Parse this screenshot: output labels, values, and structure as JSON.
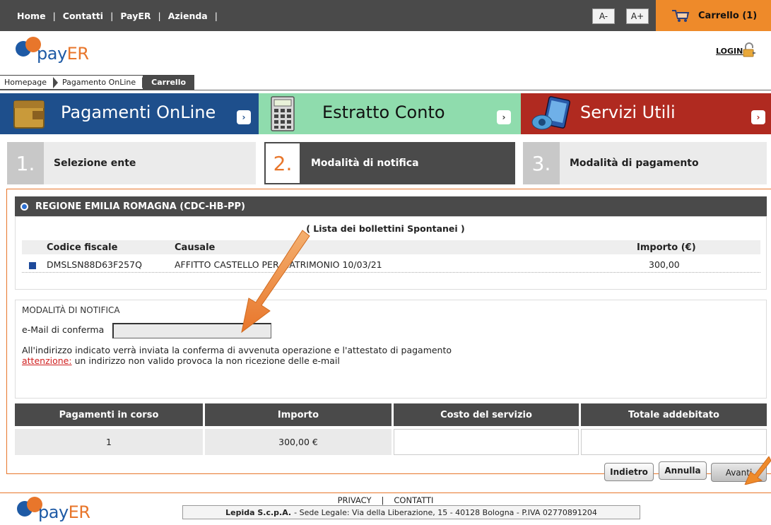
{
  "topnav": {
    "links": [
      "Home",
      "Contatti",
      "PayER",
      "Azienda"
    ],
    "font_decrease": "A-",
    "font_increase": "A+",
    "cart_label": "Carrello (1)"
  },
  "header": {
    "logo_text_a": "pay",
    "logo_text_b": "ER",
    "login": "LOGIN"
  },
  "breadcrumb": [
    "Homepage",
    "Pagamento OnLine",
    "Carrello"
  ],
  "tiles": [
    {
      "label": "Pagamenti OnLine",
      "color": "#1e4f8c",
      "text_color": "#ffffff"
    },
    {
      "label": "Estratto Conto",
      "color": "#8fdcad",
      "text_color": "#111111"
    },
    {
      "label": "Servizi Utili",
      "color": "#b02a20",
      "text_color": "#ffffff"
    }
  ],
  "steps": [
    {
      "num": "1.",
      "label": "Selezione ente"
    },
    {
      "num": "2.",
      "label": "Modalità di notifica"
    },
    {
      "num": "3.",
      "label": "Modalità di pagamento"
    }
  ],
  "ente": {
    "name": "REGIONE EMILIA ROMAGNA (CDC-HB-PP)",
    "list_title": "( Lista dei bollettini Spontanei )",
    "columns": [
      "Codice fiscale",
      "Causale",
      "Importo (€)"
    ],
    "rows": [
      {
        "codice": "DMSLSN88D63F257Q",
        "causale": "AFFITTO CASTELLO PER MATRIMONIO 10/03/21",
        "importo": "300,00"
      }
    ]
  },
  "notifica": {
    "title": "MODALITÀ DI NOTIFICA",
    "email_label": "e-Mail di conferma",
    "email_value": "",
    "info": "All'indirizzo indicato verrà  inviata la conferma di avvenuta operazione e l'attestato di pagamento",
    "warning_label": "attenzione:",
    "warning_text": " un indirizzo non valido provoca la non ricezione delle e-mail"
  },
  "summary": {
    "headers": [
      "Pagamenti in corso",
      "Importo",
      "Costo del servizio",
      "Totale addebitato"
    ],
    "values": [
      "1",
      "300,00 €",
      "",
      ""
    ]
  },
  "buttons": {
    "back": "Indietro",
    "cancel": "Annulla",
    "next": "Avanti"
  },
  "footer": {
    "privacy": "PRIVACY",
    "separator": "|",
    "contacts": "CONTATTI",
    "company": "Lepida S.c.p.A.",
    "address": "- Sede Legale: Via della Liberazione, 15 - 40128 Bologna - P.IVA 02770891204"
  },
  "colors": {
    "accent_orange": "#ee8a2a",
    "dark_bar": "#4a4a4a",
    "brand_blue": "#1e5aa5"
  }
}
